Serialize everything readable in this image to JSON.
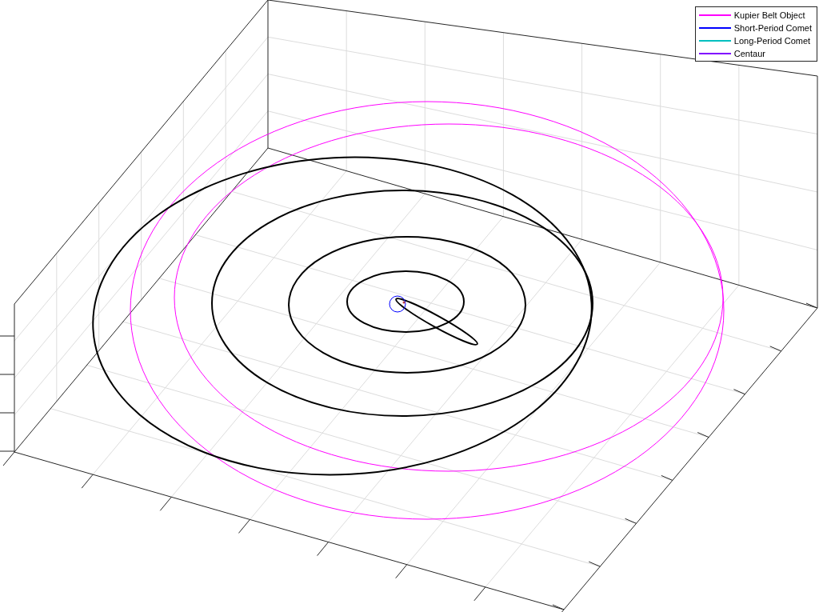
{
  "legend": [
    {
      "label": "Kupier Belt Object",
      "color": "#ff00ff"
    },
    {
      "label": "Short-Period Comet",
      "color": "#0000ff"
    },
    {
      "label": "Long-Period Comet",
      "color": "#00bfbf"
    },
    {
      "label": "Centaur",
      "color": "#8000ff"
    }
  ]
}
